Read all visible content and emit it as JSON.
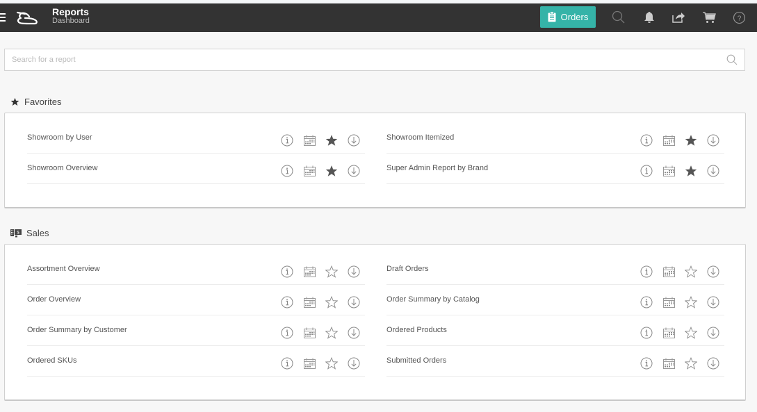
{
  "header": {
    "title": "Reports",
    "subtitle": "Dashboard",
    "orders_button_label": "Orders",
    "icons": [
      "menu-icon",
      "logo",
      "clipboard-icon",
      "search-icon",
      "bell-icon",
      "share-icon",
      "cart-icon",
      "help-icon"
    ]
  },
  "search": {
    "placeholder": "Search for a report",
    "value": ""
  },
  "sections": [
    {
      "title": "Favorites",
      "icon": "star-icon",
      "reports": [
        {
          "name": "Showroom by User",
          "favorite": true
        },
        {
          "name": "Showroom Itemized",
          "favorite": true
        },
        {
          "name": "Showroom Overview",
          "favorite": true
        },
        {
          "name": "Super Admin Report by Brand",
          "favorite": true
        }
      ]
    },
    {
      "title": "Sales",
      "icon": "cash-register-icon",
      "reports": [
        {
          "name": "Assortment Overview",
          "favorite": false
        },
        {
          "name": "Draft Orders",
          "favorite": false
        },
        {
          "name": "Order Overview",
          "favorite": false
        },
        {
          "name": "Order Summary by Catalog",
          "favorite": false
        },
        {
          "name": "Order Summary by Customer",
          "favorite": false
        },
        {
          "name": "Ordered Products",
          "favorite": false
        },
        {
          "name": "Ordered SKUs",
          "favorite": false
        },
        {
          "name": "Submitted Orders",
          "favorite": false
        }
      ]
    }
  ],
  "row_actions": [
    "info",
    "schedule",
    "favorite",
    "download"
  ],
  "colors": {
    "topbar": "#333333",
    "accent": "#35b3a8",
    "background": "#f7f7f7",
    "icon_gray": "#888888",
    "star_filled": "#555555"
  }
}
